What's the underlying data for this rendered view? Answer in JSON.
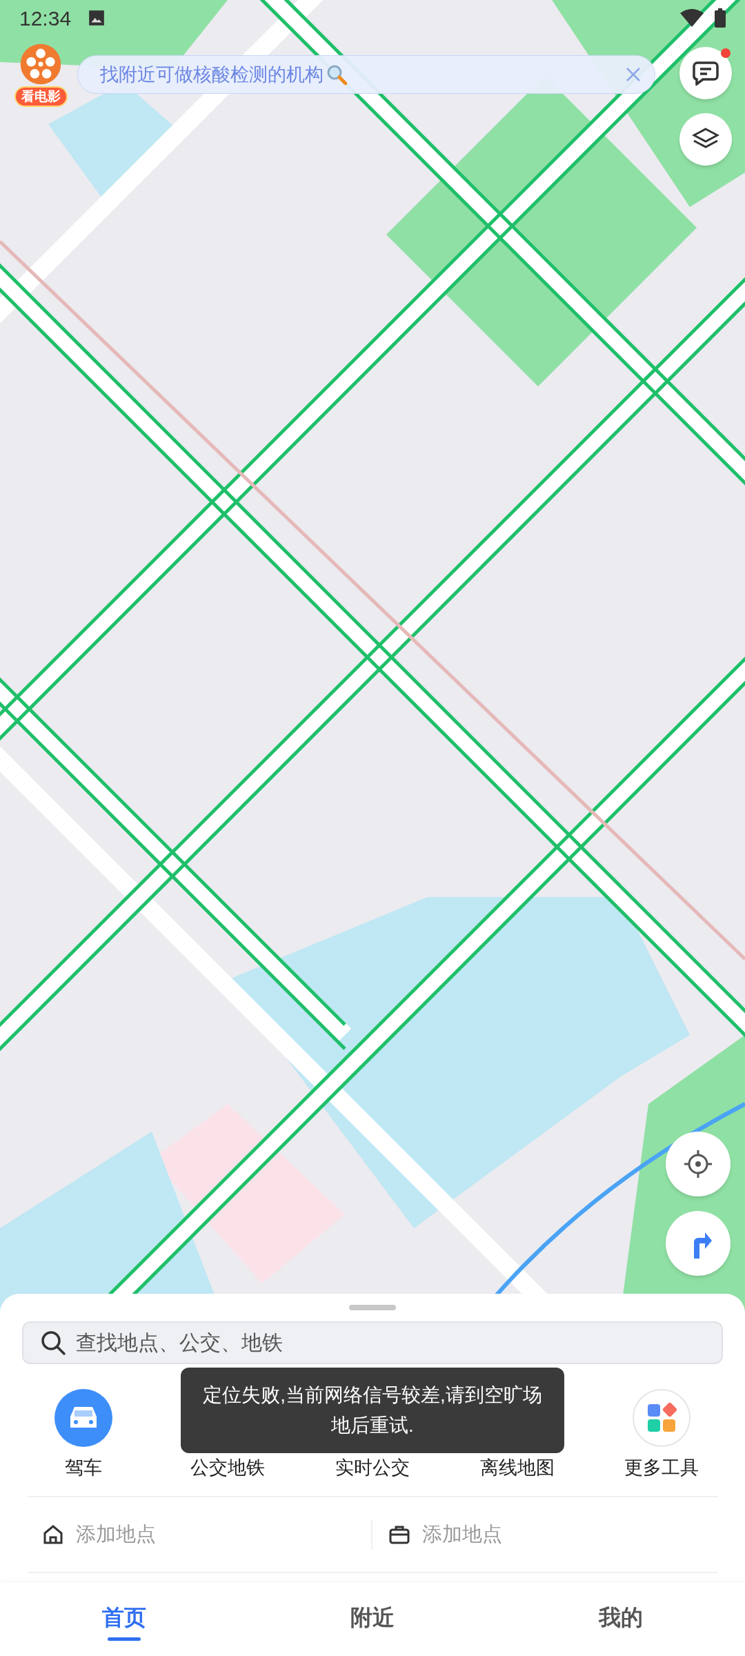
{
  "status_bar": {
    "time": "12:34"
  },
  "promo": {
    "label": "看电影"
  },
  "banner": {
    "text": "找附近可做核酸检测的机构"
  },
  "messages": {
    "unread": true
  },
  "search": {
    "placeholder": "查找地点、公交、地铁"
  },
  "tools": [
    {
      "kind": "drive",
      "label": "驾车"
    },
    {
      "kind": "bus",
      "label": "公交地铁"
    },
    {
      "kind": "realtime",
      "label": "实时公交"
    },
    {
      "kind": "offline",
      "label": "离线地图"
    },
    {
      "kind": "more",
      "label": "更多工具"
    }
  ],
  "places": [
    {
      "kind": "home",
      "label": "添加地点"
    },
    {
      "kind": "work",
      "label": "添加地点"
    }
  ],
  "toast": {
    "text": "定位失败,当前网络信号较差,请到空旷场地后重试."
  },
  "tabs": [
    {
      "label": "首页",
      "selected": true
    },
    {
      "label": "附近",
      "selected": false
    },
    {
      "label": "我的",
      "selected": false
    }
  ]
}
